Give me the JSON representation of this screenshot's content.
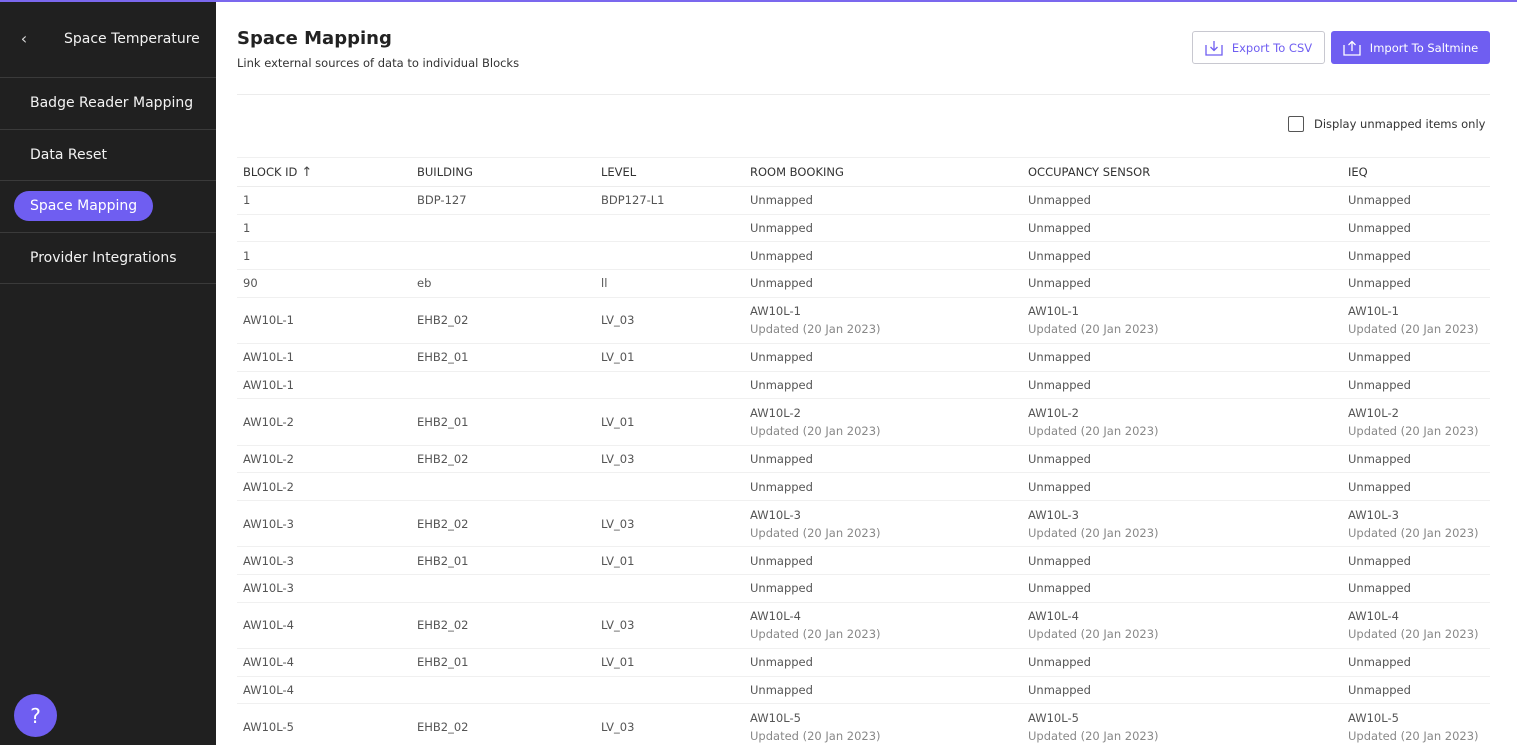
{
  "sidebar": {
    "title": "Space Temperature",
    "items": [
      {
        "label": "Badge Reader Mapping"
      },
      {
        "label": "Data Reset"
      },
      {
        "label": "Space Mapping"
      },
      {
        "label": "Provider Integrations"
      }
    ],
    "help_label": "?"
  },
  "header": {
    "title": "Space Mapping",
    "subtitle": "Link external sources of data to individual Blocks",
    "export_label": "Export To CSV",
    "import_label": "Import To Saltmine"
  },
  "filter": {
    "label": "Display unmapped items only"
  },
  "table": {
    "columns": [
      "BLOCK ID",
      "BUILDING",
      "LEVEL",
      "ROOM BOOKING",
      "OCCUPANCY SENSOR",
      "IEQ"
    ],
    "rows": [
      {
        "block": "1",
        "building": "BDP-127",
        "level": "BDP127-L1",
        "room": "Unmapped",
        "room_sub": "",
        "occ": "Unmapped",
        "occ_sub": "",
        "ieq": "Unmapped",
        "ieq_sub": ""
      },
      {
        "block": "1",
        "building": "",
        "level": "",
        "room": "Unmapped",
        "room_sub": "",
        "occ": "Unmapped",
        "occ_sub": "",
        "ieq": "Unmapped",
        "ieq_sub": ""
      },
      {
        "block": "1",
        "building": "",
        "level": "",
        "room": "Unmapped",
        "room_sub": "",
        "occ": "Unmapped",
        "occ_sub": "",
        "ieq": "Unmapped",
        "ieq_sub": ""
      },
      {
        "block": "90",
        "building": "eb",
        "level": "ll",
        "room": "Unmapped",
        "room_sub": "",
        "occ": "Unmapped",
        "occ_sub": "",
        "ieq": "Unmapped",
        "ieq_sub": ""
      },
      {
        "block": "AW10L-1",
        "building": "EHB2_02",
        "level": "LV_03",
        "room": "AW10L-1",
        "room_sub": "Updated (20 Jan 2023)",
        "occ": "AW10L-1",
        "occ_sub": "Updated (20 Jan 2023)",
        "ieq": "AW10L-1",
        "ieq_sub": "Updated (20 Jan 2023)"
      },
      {
        "block": "AW10L-1",
        "building": "EHB2_01",
        "level": "LV_01",
        "room": "Unmapped",
        "room_sub": "",
        "occ": "Unmapped",
        "occ_sub": "",
        "ieq": "Unmapped",
        "ieq_sub": ""
      },
      {
        "block": "AW10L-1",
        "building": "",
        "level": "",
        "room": "Unmapped",
        "room_sub": "",
        "occ": "Unmapped",
        "occ_sub": "",
        "ieq": "Unmapped",
        "ieq_sub": ""
      },
      {
        "block": "AW10L-2",
        "building": "EHB2_01",
        "level": "LV_01",
        "room": "AW10L-2",
        "room_sub": "Updated (20 Jan 2023)",
        "occ": "AW10L-2",
        "occ_sub": "Updated (20 Jan 2023)",
        "ieq": "AW10L-2",
        "ieq_sub": "Updated (20 Jan 2023)"
      },
      {
        "block": "AW10L-2",
        "building": "EHB2_02",
        "level": "LV_03",
        "room": "Unmapped",
        "room_sub": "",
        "occ": "Unmapped",
        "occ_sub": "",
        "ieq": "Unmapped",
        "ieq_sub": ""
      },
      {
        "block": "AW10L-2",
        "building": "",
        "level": "",
        "room": "Unmapped",
        "room_sub": "",
        "occ": "Unmapped",
        "occ_sub": "",
        "ieq": "Unmapped",
        "ieq_sub": ""
      },
      {
        "block": "AW10L-3",
        "building": "EHB2_02",
        "level": "LV_03",
        "room": "AW10L-3",
        "room_sub": "Updated (20 Jan 2023)",
        "occ": "AW10L-3",
        "occ_sub": "Updated (20 Jan 2023)",
        "ieq": "AW10L-3",
        "ieq_sub": "Updated (20 Jan 2023)"
      },
      {
        "block": "AW10L-3",
        "building": "EHB2_01",
        "level": "LV_01",
        "room": "Unmapped",
        "room_sub": "",
        "occ": "Unmapped",
        "occ_sub": "",
        "ieq": "Unmapped",
        "ieq_sub": ""
      },
      {
        "block": "AW10L-3",
        "building": "",
        "level": "",
        "room": "Unmapped",
        "room_sub": "",
        "occ": "Unmapped",
        "occ_sub": "",
        "ieq": "Unmapped",
        "ieq_sub": ""
      },
      {
        "block": "AW10L-4",
        "building": "EHB2_02",
        "level": "LV_03",
        "room": "AW10L-4",
        "room_sub": "Updated (20 Jan 2023)",
        "occ": "AW10L-4",
        "occ_sub": "Updated (20 Jan 2023)",
        "ieq": "AW10L-4",
        "ieq_sub": "Updated (20 Jan 2023)"
      },
      {
        "block": "AW10L-4",
        "building": "EHB2_01",
        "level": "LV_01",
        "room": "Unmapped",
        "room_sub": "",
        "occ": "Unmapped",
        "occ_sub": "",
        "ieq": "Unmapped",
        "ieq_sub": ""
      },
      {
        "block": "AW10L-4",
        "building": "",
        "level": "",
        "room": "Unmapped",
        "room_sub": "",
        "occ": "Unmapped",
        "occ_sub": "",
        "ieq": "Unmapped",
        "ieq_sub": ""
      },
      {
        "block": "AW10L-5",
        "building": "EHB2_02",
        "level": "LV_03",
        "room": "AW10L-5",
        "room_sub": "Updated (20 Jan 2023)",
        "occ": "AW10L-5",
        "occ_sub": "Updated (20 Jan 2023)",
        "ieq": "AW10L-5",
        "ieq_sub": "Updated (20 Jan 2023)"
      }
    ]
  },
  "colors": {
    "accent": "#6f5ef1",
    "sidebar_bg": "#202020"
  }
}
